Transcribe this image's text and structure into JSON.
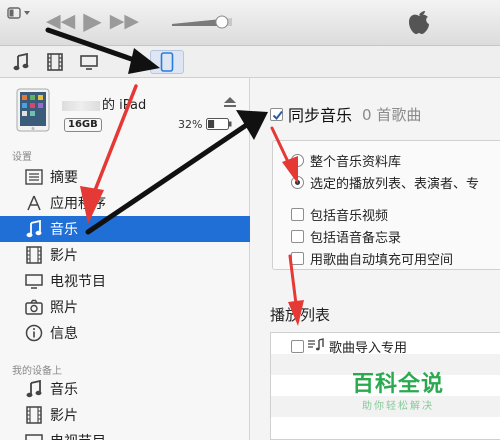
{
  "toolbar": {
    "icons": [
      "menu-icon",
      "rewind-icon",
      "play-icon",
      "fast-forward-icon",
      "volume-slider",
      "apple-logo-icon"
    ],
    "volume_level": 0.85
  },
  "media_bar": {
    "icons": [
      "music-note-icon",
      "film-icon",
      "tv-icon",
      "ipad-device-icon"
    ],
    "active": "ipad-device-icon"
  },
  "device": {
    "name_suffix": "的 iPad",
    "capacity": "16GB",
    "battery_pct": "32%",
    "battery_level": 0.32
  },
  "sidebar": {
    "settings_header": "设置",
    "settings_items": [
      {
        "label": "摘要",
        "icon": "summary-icon"
      },
      {
        "label": "应用程序",
        "icon": "apps-icon"
      },
      {
        "label": "音乐",
        "icon": "music-note-icon",
        "selected": true
      },
      {
        "label": "影片",
        "icon": "film-icon"
      },
      {
        "label": "电视节目",
        "icon": "tv-icon"
      },
      {
        "label": "照片",
        "icon": "camera-icon"
      },
      {
        "label": "信息",
        "icon": "info-icon"
      }
    ],
    "on_device_header": "我的设备上",
    "on_device_items": [
      {
        "label": "音乐",
        "icon": "music-note-icon"
      },
      {
        "label": "影片",
        "icon": "film-icon"
      },
      {
        "label": "电视节目",
        "icon": "tv-icon"
      }
    ]
  },
  "main": {
    "sync_label": "同步音乐",
    "sync_count": "0 首歌曲",
    "sync_checked": true,
    "radio_entire": "整个音乐资料库",
    "radio_selected": "选定的播放列表、表演者、专",
    "check_music_videos": "包括音乐视频",
    "check_voice_memos": "包括语音备忘录",
    "check_autofill": "用歌曲自动填充可用空间",
    "playlists_title": "播放列表",
    "playlists": [
      "歌曲导入专用"
    ]
  },
  "watermark": {
    "title": "百科全说",
    "subtitle": "助你轻松解决"
  },
  "colors": {
    "selection": "#1f6fd6",
    "accent_blue": "#2b7bdc",
    "annotation_red": "#e53935",
    "watermark_green": "#2aa94f"
  }
}
